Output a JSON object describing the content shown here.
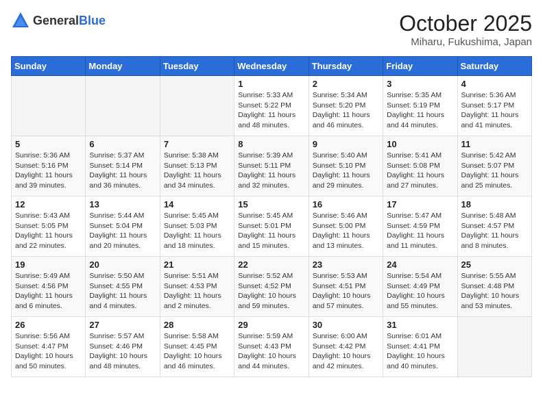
{
  "logo": {
    "text_general": "General",
    "text_blue": "Blue"
  },
  "header": {
    "month": "October 2025",
    "location": "Miharu, Fukushima, Japan"
  },
  "weekdays": [
    "Sunday",
    "Monday",
    "Tuesday",
    "Wednesday",
    "Thursday",
    "Friday",
    "Saturday"
  ],
  "weeks": [
    [
      {
        "day": "",
        "sunrise": "",
        "sunset": "",
        "daylight": ""
      },
      {
        "day": "",
        "sunrise": "",
        "sunset": "",
        "daylight": ""
      },
      {
        "day": "",
        "sunrise": "",
        "sunset": "",
        "daylight": ""
      },
      {
        "day": "1",
        "sunrise": "Sunrise: 5:33 AM",
        "sunset": "Sunset: 5:22 PM",
        "daylight": "Daylight: 11 hours and 48 minutes."
      },
      {
        "day": "2",
        "sunrise": "Sunrise: 5:34 AM",
        "sunset": "Sunset: 5:20 PM",
        "daylight": "Daylight: 11 hours and 46 minutes."
      },
      {
        "day": "3",
        "sunrise": "Sunrise: 5:35 AM",
        "sunset": "Sunset: 5:19 PM",
        "daylight": "Daylight: 11 hours and 44 minutes."
      },
      {
        "day": "4",
        "sunrise": "Sunrise: 5:36 AM",
        "sunset": "Sunset: 5:17 PM",
        "daylight": "Daylight: 11 hours and 41 minutes."
      }
    ],
    [
      {
        "day": "5",
        "sunrise": "Sunrise: 5:36 AM",
        "sunset": "Sunset: 5:16 PM",
        "daylight": "Daylight: 11 hours and 39 minutes."
      },
      {
        "day": "6",
        "sunrise": "Sunrise: 5:37 AM",
        "sunset": "Sunset: 5:14 PM",
        "daylight": "Daylight: 11 hours and 36 minutes."
      },
      {
        "day": "7",
        "sunrise": "Sunrise: 5:38 AM",
        "sunset": "Sunset: 5:13 PM",
        "daylight": "Daylight: 11 hours and 34 minutes."
      },
      {
        "day": "8",
        "sunrise": "Sunrise: 5:39 AM",
        "sunset": "Sunset: 5:11 PM",
        "daylight": "Daylight: 11 hours and 32 minutes."
      },
      {
        "day": "9",
        "sunrise": "Sunrise: 5:40 AM",
        "sunset": "Sunset: 5:10 PM",
        "daylight": "Daylight: 11 hours and 29 minutes."
      },
      {
        "day": "10",
        "sunrise": "Sunrise: 5:41 AM",
        "sunset": "Sunset: 5:08 PM",
        "daylight": "Daylight: 11 hours and 27 minutes."
      },
      {
        "day": "11",
        "sunrise": "Sunrise: 5:42 AM",
        "sunset": "Sunset: 5:07 PM",
        "daylight": "Daylight: 11 hours and 25 minutes."
      }
    ],
    [
      {
        "day": "12",
        "sunrise": "Sunrise: 5:43 AM",
        "sunset": "Sunset: 5:05 PM",
        "daylight": "Daylight: 11 hours and 22 minutes."
      },
      {
        "day": "13",
        "sunrise": "Sunrise: 5:44 AM",
        "sunset": "Sunset: 5:04 PM",
        "daylight": "Daylight: 11 hours and 20 minutes."
      },
      {
        "day": "14",
        "sunrise": "Sunrise: 5:45 AM",
        "sunset": "Sunset: 5:03 PM",
        "daylight": "Daylight: 11 hours and 18 minutes."
      },
      {
        "day": "15",
        "sunrise": "Sunrise: 5:45 AM",
        "sunset": "Sunset: 5:01 PM",
        "daylight": "Daylight: 11 hours and 15 minutes."
      },
      {
        "day": "16",
        "sunrise": "Sunrise: 5:46 AM",
        "sunset": "Sunset: 5:00 PM",
        "daylight": "Daylight: 11 hours and 13 minutes."
      },
      {
        "day": "17",
        "sunrise": "Sunrise: 5:47 AM",
        "sunset": "Sunset: 4:59 PM",
        "daylight": "Daylight: 11 hours and 11 minutes."
      },
      {
        "day": "18",
        "sunrise": "Sunrise: 5:48 AM",
        "sunset": "Sunset: 4:57 PM",
        "daylight": "Daylight: 11 hours and 8 minutes."
      }
    ],
    [
      {
        "day": "19",
        "sunrise": "Sunrise: 5:49 AM",
        "sunset": "Sunset: 4:56 PM",
        "daylight": "Daylight: 11 hours and 6 minutes."
      },
      {
        "day": "20",
        "sunrise": "Sunrise: 5:50 AM",
        "sunset": "Sunset: 4:55 PM",
        "daylight": "Daylight: 11 hours and 4 minutes."
      },
      {
        "day": "21",
        "sunrise": "Sunrise: 5:51 AM",
        "sunset": "Sunset: 4:53 PM",
        "daylight": "Daylight: 11 hours and 2 minutes."
      },
      {
        "day": "22",
        "sunrise": "Sunrise: 5:52 AM",
        "sunset": "Sunset: 4:52 PM",
        "daylight": "Daylight: 10 hours and 59 minutes."
      },
      {
        "day": "23",
        "sunrise": "Sunrise: 5:53 AM",
        "sunset": "Sunset: 4:51 PM",
        "daylight": "Daylight: 10 hours and 57 minutes."
      },
      {
        "day": "24",
        "sunrise": "Sunrise: 5:54 AM",
        "sunset": "Sunset: 4:49 PM",
        "daylight": "Daylight: 10 hours and 55 minutes."
      },
      {
        "day": "25",
        "sunrise": "Sunrise: 5:55 AM",
        "sunset": "Sunset: 4:48 PM",
        "daylight": "Daylight: 10 hours and 53 minutes."
      }
    ],
    [
      {
        "day": "26",
        "sunrise": "Sunrise: 5:56 AM",
        "sunset": "Sunset: 4:47 PM",
        "daylight": "Daylight: 10 hours and 50 minutes."
      },
      {
        "day": "27",
        "sunrise": "Sunrise: 5:57 AM",
        "sunset": "Sunset: 4:46 PM",
        "daylight": "Daylight: 10 hours and 48 minutes."
      },
      {
        "day": "28",
        "sunrise": "Sunrise: 5:58 AM",
        "sunset": "Sunset: 4:45 PM",
        "daylight": "Daylight: 10 hours and 46 minutes."
      },
      {
        "day": "29",
        "sunrise": "Sunrise: 5:59 AM",
        "sunset": "Sunset: 4:43 PM",
        "daylight": "Daylight: 10 hours and 44 minutes."
      },
      {
        "day": "30",
        "sunrise": "Sunrise: 6:00 AM",
        "sunset": "Sunset: 4:42 PM",
        "daylight": "Daylight: 10 hours and 42 minutes."
      },
      {
        "day": "31",
        "sunrise": "Sunrise: 6:01 AM",
        "sunset": "Sunset: 4:41 PM",
        "daylight": "Daylight: 10 hours and 40 minutes."
      },
      {
        "day": "",
        "sunrise": "",
        "sunset": "",
        "daylight": ""
      }
    ]
  ]
}
